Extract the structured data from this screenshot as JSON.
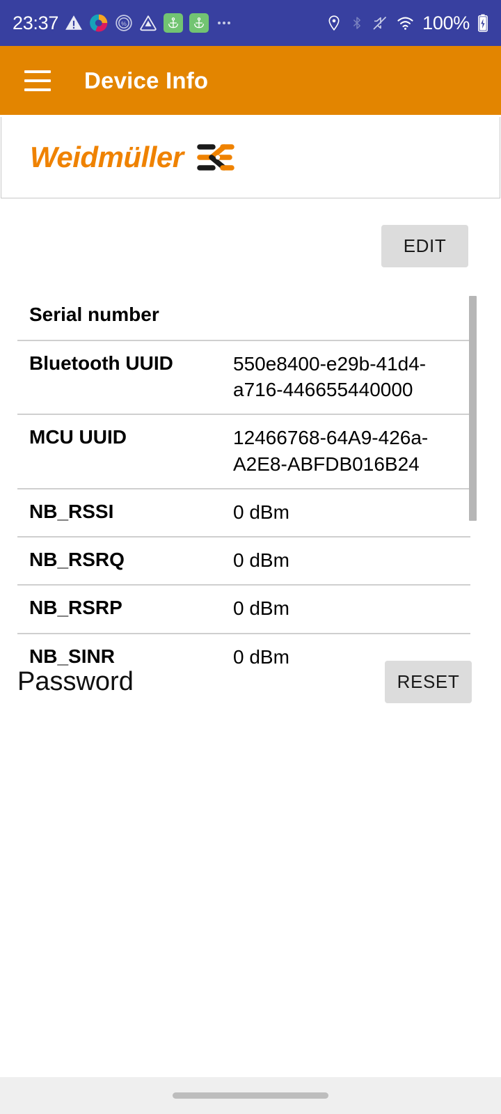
{
  "status_bar": {
    "time": "23:37",
    "battery_percent": "100%",
    "background_color": "#3840a0",
    "left_icons": [
      {
        "name": "warning-triangle-icon"
      },
      {
        "name": "swirl-app-icon"
      },
      {
        "name": "percent-circle-icon"
      },
      {
        "name": "triangle-drop-icon"
      },
      {
        "name": "anchor-notification-icon-1"
      },
      {
        "name": "anchor-notification-icon-2"
      },
      {
        "name": "more-notifications-icon"
      }
    ],
    "right_icons": [
      {
        "name": "location-pin-icon"
      },
      {
        "name": "bluetooth-icon"
      },
      {
        "name": "mute-icon"
      },
      {
        "name": "wifi-icon"
      },
      {
        "name": "battery-icon"
      }
    ]
  },
  "app_bar": {
    "title": "Device Info",
    "menu_icon": "hamburger-menu-icon",
    "background_color": "#e38500"
  },
  "logo": {
    "brand_text": "Weidmüller",
    "brand_color": "#ef8200",
    "mark_name": "weidmueller-mark-icon"
  },
  "toolbar": {
    "edit_label": "EDIT"
  },
  "table": {
    "rows": [
      {
        "label": "Serial number",
        "value": ""
      },
      {
        "label": "Bluetooth UUID",
        "value": "550e8400-e29b-41d4-a716-446655440000"
      },
      {
        "label": "MCU UUID",
        "value": "12466768-64A9-426a-A2E8-ABFDB016B24"
      },
      {
        "label": "NB_RSSI",
        "value": "0 dBm"
      },
      {
        "label": "NB_RSRQ",
        "value": "0 dBm"
      },
      {
        "label": "NB_RSRP",
        "value": "0 dBm"
      },
      {
        "label": "NB_SINR",
        "value": "0 dBm"
      }
    ]
  },
  "password_section": {
    "label": "Password",
    "reset_label": "RESET"
  },
  "nav_bar": {
    "handle_name": "home-gesture-pill"
  }
}
